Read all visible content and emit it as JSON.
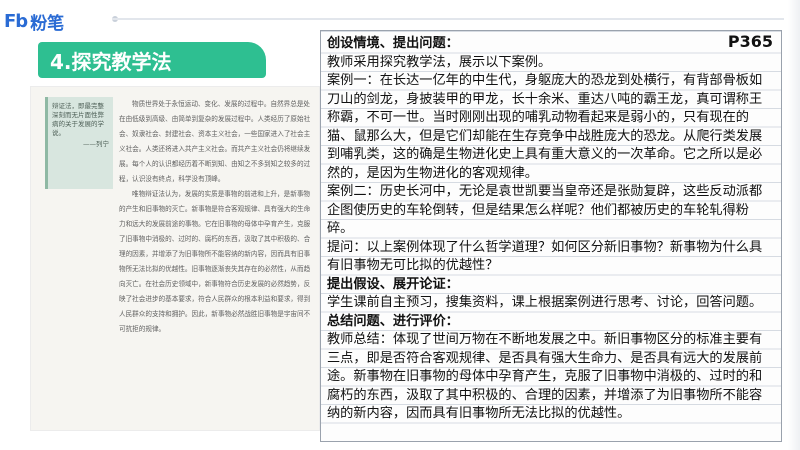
{
  "brand": {
    "mark": "Fb",
    "name": "粉笔"
  },
  "section_title": "4.探究教学法",
  "page_number": "P365",
  "book_page": {
    "quote_lines": [
      "辩证法，即最完整深刻而无片面性弊病的关于发展的学说。"
    ],
    "quote_author": "——列宁",
    "paragraphs": [
      "物质世界处于永恒运动、变化、发展的过程中。自然界总是处在由低级到高级、由简单到复杂的发展过程中。人类经历了原始社会、奴隶社会、封建社会、资本主义社会，一些国家进入了社会主义社会。人类还将进入共产主义社会。而共产主义社会仍将继续发展。每个人的认识都经历着不断到知、由知之不多到知之较多的过程，认识没有终点，科学没有顶峰。",
      "唯物辩证法认为，发展的实质是事物的前进和上升，是新事物的产生和旧事物的灭亡。新事物是符合客观规律、具有强大的生命力和远大的发展前途的事物。它在旧事物的母体中孕育产生，克服了旧事物中消极的、过时的、腐朽的东西，汲取了其中积极的、合理的因素，并增添了为旧事物所不能容纳的新内容，因而具有旧事物所无法比拟的优越性。旧事物逐渐丧失其存在的必然性，从而趋向灭亡。在社会历史领域中，新事物符合历史发展的必然趋势，反映了社会进步的基本要求，符合人民群众的根本利益和要求，得到人民群众的支持和拥护。因此，新事物必然战胜旧事物是宇宙间不可抗拒的规律。"
    ]
  },
  "notes": {
    "heading_1": "创设情境、提出问题：",
    "intro": "教师采用探究教学法，展示以下案例。",
    "case_1": "案例一：在长达一亿年的中生代，身躯庞大的恐龙到处横行，有背部骨板如刀山的剑龙，身披装甲的甲龙，长十余米、重达八吨的霸王龙，真可谓称王称霸，不可一世。当时刚刚出现的哺乳动物看起来是弱小的，只有现在的猫、鼠那么大，但是它们却能在生存竞争中战胜庞大的恐龙。从爬行类发展到哺乳类，这的确是生物进化史上具有重大意义的一次革命。它之所以是必然的，是因为生物进化的客观规律。",
    "case_2": "案例二：历史长河中，无论是袁世凯要当皇帝还是张勋复辟，这些反动派都企图使历史的车轮倒转，但是结果怎么样呢？他们都被历史的车轮轧得粉碎。",
    "question": "提问：以上案例体现了什么哲学道理？如何区分新旧事物？新事物为什么具有旧事物无可比拟的优越性？",
    "heading_2": "提出假设、展开论证：",
    "argument": "学生课前自主预习，搜集资料，课上根据案例进行思考、讨论，回答问题。",
    "heading_3": "总结问题、进行评价：",
    "summary": "教师总结：体现了世间万物在不断地发展之中。新旧事物区分的标准主要有三点，即是否符合客观规律、是否具有强大生命力、是否具有远大的发展前途。新事物在旧事物的母体中孕育产生，克服了旧事物中消极的、过时的和腐朽的东西，汲取了其中积极的、合理的因素，并增添了为旧事物所不能容纳的新内容，因而具有旧事物所无法比拟的优越性。"
  }
}
